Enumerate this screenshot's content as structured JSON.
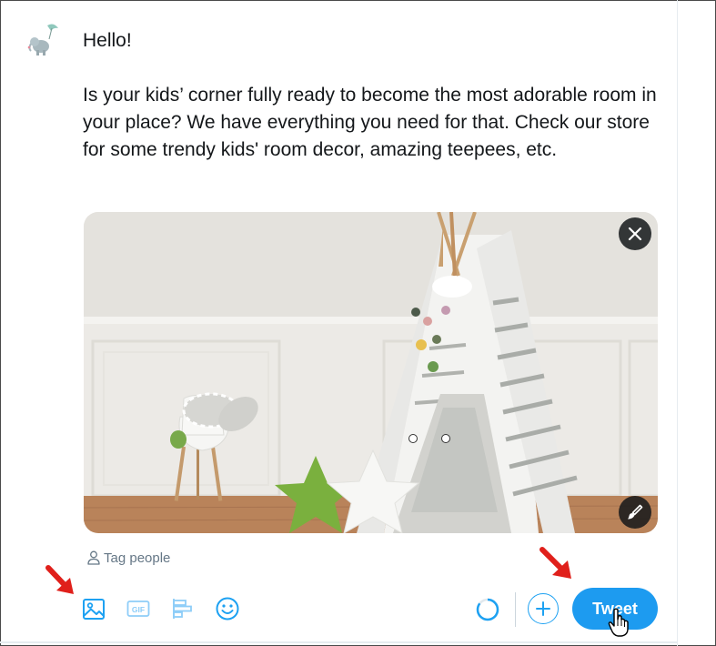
{
  "compose": {
    "greeting": "Hello!",
    "body": "Is your kids’ corner fully ready to become the most adorable room in your place? We have everything you need for that. Check our store for some trendy kids' room decor, amazing teepees, etc."
  },
  "media": {
    "close_icon": "close-icon",
    "edit_icon": "brush-icon"
  },
  "tag_people": {
    "label": "Tag people",
    "icon": "person-icon"
  },
  "toolbar": {
    "icons": [
      "image-icon",
      "gif-icon",
      "poll-icon",
      "emoji-icon"
    ],
    "gif_text": "GIF",
    "tweet_label": "Tweet",
    "progress_percent": 85
  },
  "colors": {
    "accent": "#1d9bf0",
    "annotation_arrow": "#e0201b",
    "text": "#14171a",
    "muted": "#657786"
  }
}
